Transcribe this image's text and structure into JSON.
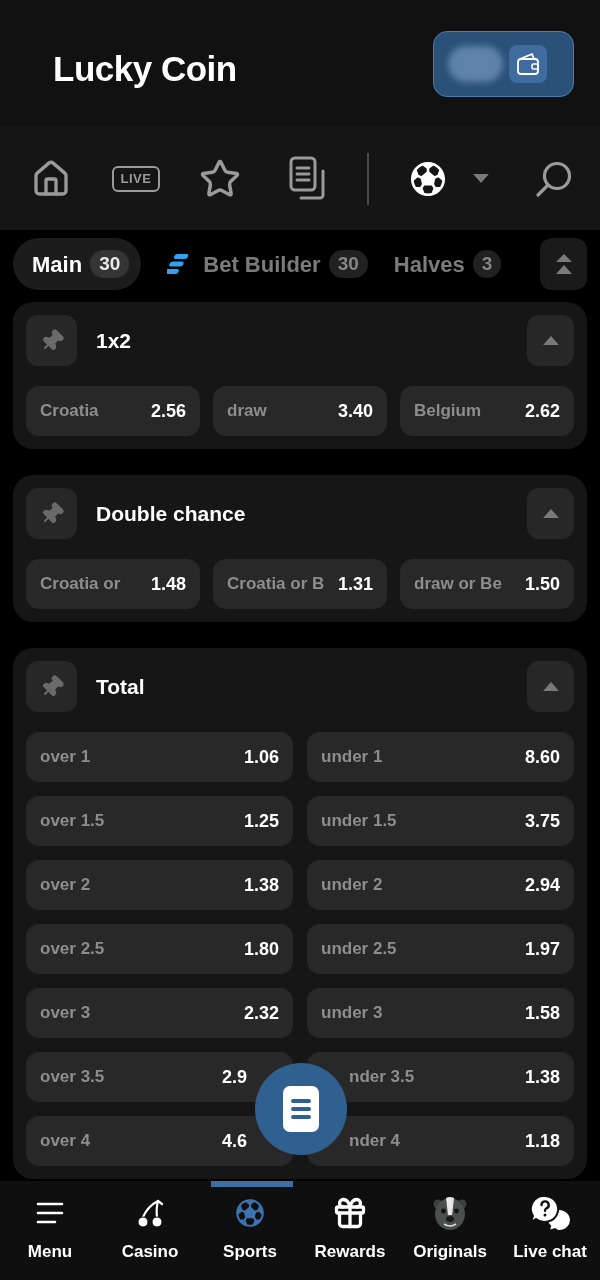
{
  "header": {
    "logo": "Lucky Coin"
  },
  "toolbar": {
    "live_label": "LIVE"
  },
  "market_tabs": [
    {
      "label": "Main",
      "count": "30",
      "selected": true,
      "kind": "plain"
    },
    {
      "label": "Bet Builder",
      "count": "30",
      "selected": false,
      "kind": "builder"
    },
    {
      "label": "Halves",
      "count": "3",
      "selected": false,
      "kind": "plain"
    }
  ],
  "markets": [
    {
      "title": "1x2",
      "expanded": true,
      "rows": [
        [
          {
            "label": "Croatia",
            "odds": "2.56"
          },
          {
            "label": "draw",
            "odds": "3.40"
          },
          {
            "label": "Belgium",
            "odds": "2.62"
          }
        ]
      ]
    },
    {
      "title": "Double chance",
      "expanded": true,
      "rows": [
        [
          {
            "label": "Croatia or",
            "odds": "1.48"
          },
          {
            "label": "Croatia or B",
            "odds": "1.31"
          },
          {
            "label": "draw or Be",
            "odds": "1.50"
          }
        ]
      ]
    },
    {
      "title": "Total",
      "expanded": true,
      "rows": [
        [
          {
            "label": "over 1",
            "odds": "1.06"
          },
          {
            "label": "under 1",
            "odds": "8.60"
          }
        ],
        [
          {
            "label": "over 1.5",
            "odds": "1.25"
          },
          {
            "label": "under 1.5",
            "odds": "3.75"
          }
        ],
        [
          {
            "label": "over 2",
            "odds": "1.38"
          },
          {
            "label": "under 2",
            "odds": "2.94"
          }
        ],
        [
          {
            "label": "over 2.5",
            "odds": "1.80"
          },
          {
            "label": "under 2.5",
            "odds": "1.97"
          }
        ],
        [
          {
            "label": "over 3",
            "odds": "2.32"
          },
          {
            "label": "under 3",
            "odds": "1.58"
          }
        ],
        [
          {
            "label": "over 3.5",
            "odds": "2.9"
          },
          {
            "label": "nder 3.5",
            "odds": "1.38"
          }
        ],
        [
          {
            "label": "over 4",
            "odds": "4.6"
          },
          {
            "label": "nder 4",
            "odds": "1.18"
          }
        ]
      ]
    }
  ],
  "bottom_nav": [
    {
      "label": "Menu",
      "selected": false
    },
    {
      "label": "Casino",
      "selected": false
    },
    {
      "label": "Sports",
      "selected": true
    },
    {
      "label": "Rewards",
      "selected": false
    },
    {
      "label": "Originals",
      "selected": false
    },
    {
      "label": "Live chat",
      "selected": false
    }
  ]
}
